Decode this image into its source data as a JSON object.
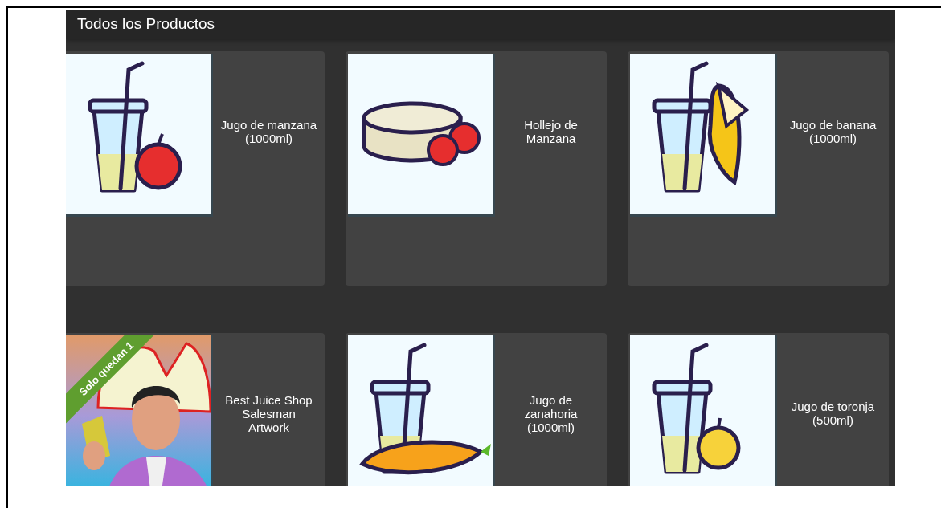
{
  "title": "Todos los Productos",
  "products": [
    {
      "name": "Jugo de manzana (1000ml)",
      "kind": "picture"
    },
    {
      "name": "Hollejo de Manzana",
      "kind": "picture"
    },
    {
      "name": "Jugo de banana (1000ml)",
      "kind": "picture"
    },
    {
      "name": "Best Juice Shop Salesman Artwork",
      "kind": "picture",
      "badge": "Solo quedan 1"
    },
    {
      "name": "Jugo de zanahoria (1000ml)",
      "kind": "picture"
    },
    {
      "name": "Jugo de toronja (500ml)",
      "kind": "picture"
    }
  ]
}
